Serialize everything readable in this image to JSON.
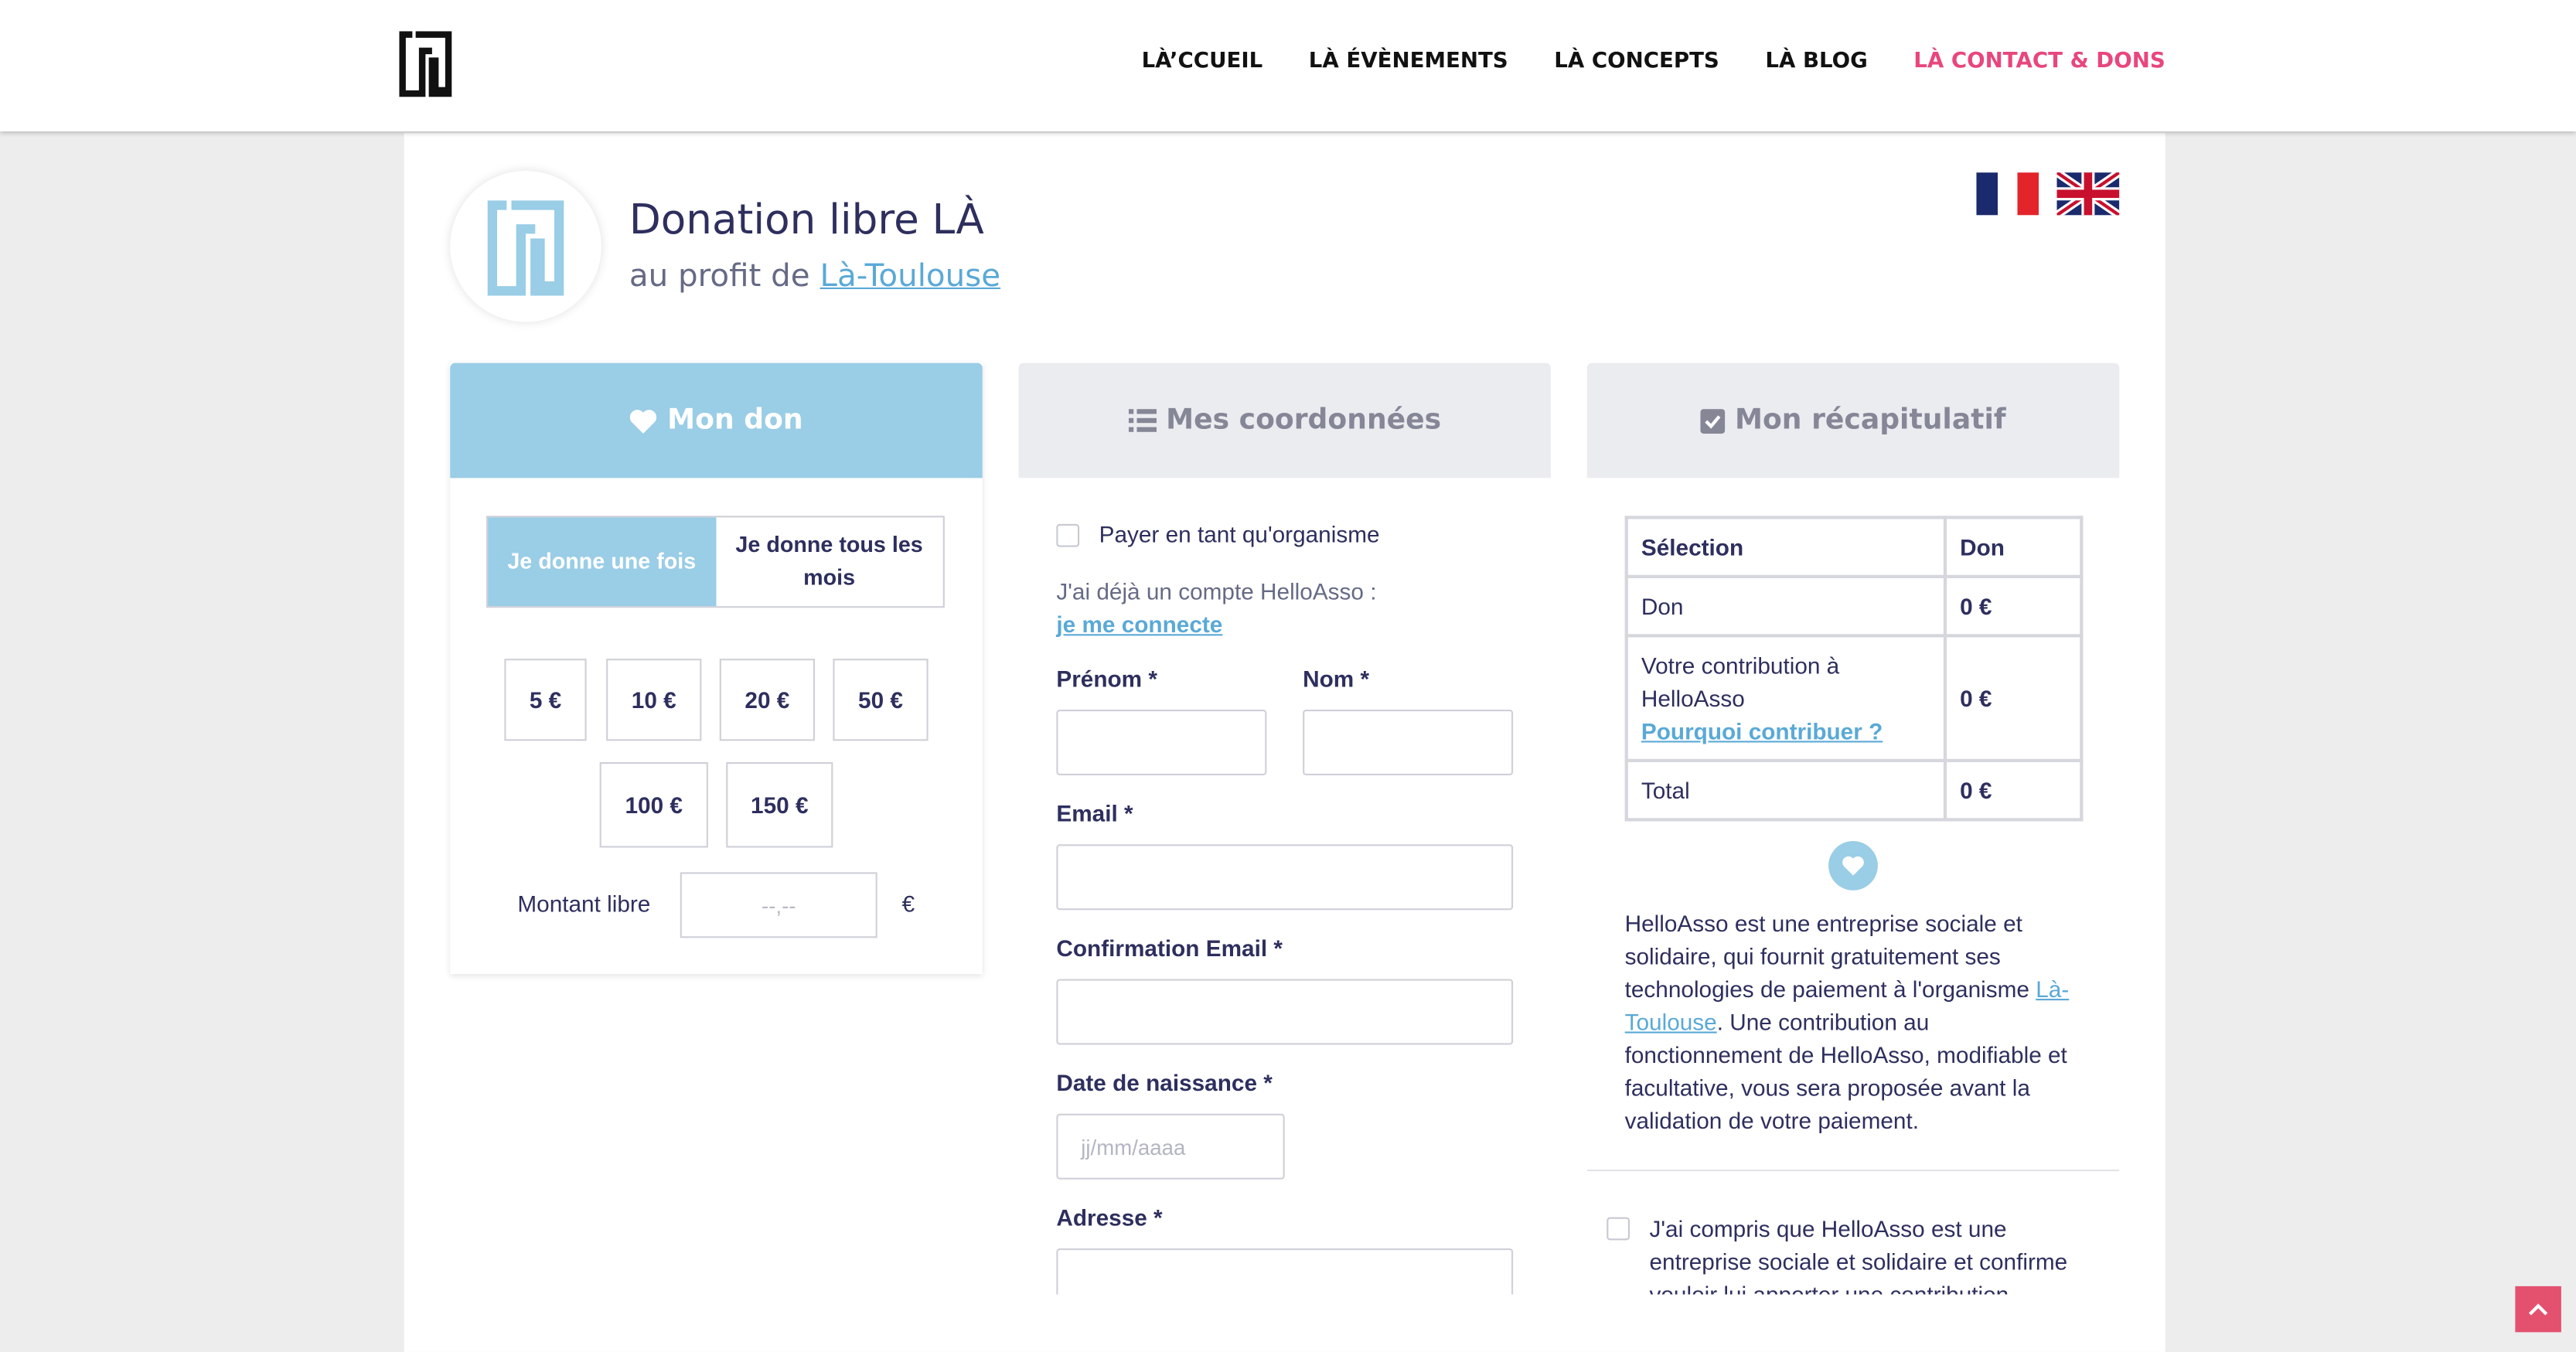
{
  "nav": {
    "items": [
      {
        "label": "LÀ’CCUEIL"
      },
      {
        "label": "LÀ ÉVÈNEMENTS"
      },
      {
        "label": "LÀ CONCEPTS"
      },
      {
        "label": "LÀ BLOG"
      },
      {
        "label": "LÀ CONTACT & DONS",
        "active": true
      }
    ],
    "active_color": "#e8467c"
  },
  "form": {
    "title": "Donation libre LÀ",
    "subtitle_prefix": "au profit de",
    "org_name": "Là-Toulouse"
  },
  "languages": [
    "fr-flag-icon",
    "uk-flag-icon"
  ],
  "steps": [
    {
      "label": "Mon don",
      "icon": "heart-icon",
      "active": true
    },
    {
      "label": "Mes coordonnées",
      "icon": "list-icon",
      "active": false
    },
    {
      "label": "Mon récapitulatif",
      "icon": "check-square-icon",
      "active": false
    }
  ],
  "don": {
    "once": "Je donne une fois",
    "monthly": "Je donne tous les mois",
    "amounts": [
      "5 €",
      "10 €",
      "20 €",
      "50 €",
      "100 €",
      "150 €"
    ],
    "libre_label": "Montant libre",
    "libre_placeholder": "--,--",
    "currency": "€"
  },
  "coords": {
    "org_checkbox": "Payer en tant qu'organisme",
    "account_text": "J'ai déjà un compte HelloAsso :",
    "login_link": "je me connecte",
    "prenom": "Prénom *",
    "nom": "Nom *",
    "email": "Email *",
    "email_confirm": "Confirmation Email *",
    "birthdate": "Date de naissance *",
    "birthdate_placeholder": "jj/mm/aaaa",
    "address": "Adresse *"
  },
  "recap": {
    "headers": [
      "Sélection",
      "Don"
    ],
    "rows": [
      {
        "label": "Don",
        "value": "0 €"
      },
      {
        "label": "Votre contribution à HelloAsso",
        "link": "Pourquoi contribuer ?",
        "value": "0 €"
      },
      {
        "label": "Total",
        "value": "0 €"
      }
    ],
    "info_before": "HelloAsso est une entreprise sociale et solidaire, qui fournit gratuitement ses technologies de paiement à l'organisme ",
    "info_link": "Là-Toulouse",
    "info_after": ". Une contribution au fonctionnement de HelloAsso, modifiable et facultative, vous sera proposée avant la validation de votre paiement.",
    "consent": "J'ai compris que HelloAsso est une entreprise sociale et solidaire et confirme vouloir lui apporter une contribution"
  },
  "colors": {
    "primary": "#9acde6",
    "text": "#2e2f5e",
    "scroll_top": "#e3516f"
  }
}
